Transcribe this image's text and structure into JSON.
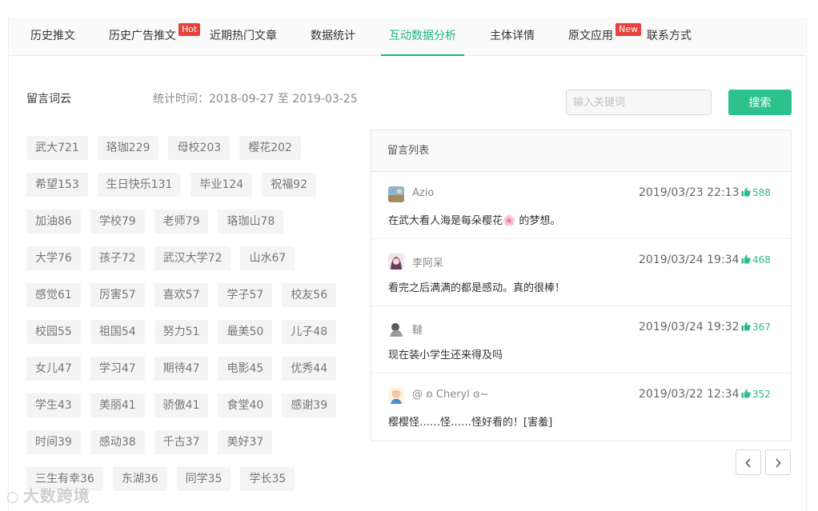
{
  "tabs": [
    {
      "label": "历史推文",
      "active": false
    },
    {
      "label": "历史广告推文",
      "active": false,
      "badge": "Hot"
    },
    {
      "label": "近期热门文章",
      "active": false
    },
    {
      "label": "数据统计",
      "active": false
    },
    {
      "label": "互动数据分析",
      "active": true
    },
    {
      "label": "主体详情",
      "active": false
    },
    {
      "label": "原文应用",
      "active": false,
      "badge": "New"
    },
    {
      "label": "联系方式",
      "active": false
    }
  ],
  "wordcloud": {
    "title": "留言词云",
    "stat_time": "统计时间：2018-09-27 至 2019-03-25",
    "rows": [
      [
        "武大721",
        "珞珈229",
        "母校203",
        "樱花202"
      ],
      [
        "希望153",
        "生日快乐131",
        "毕业124",
        "祝福92"
      ],
      [
        "加油86",
        "学校79",
        "老师79",
        "珞珈山78"
      ],
      [
        "大学76",
        "孩子72",
        "武汉大学72",
        "山水67"
      ],
      [
        "感觉61",
        "厉害57",
        "喜欢57",
        "学子57",
        "校友56"
      ],
      [
        "校园55",
        "祖国54",
        "努力51",
        "最美50",
        "儿子48"
      ],
      [
        "女儿47",
        "学习47",
        "期待47",
        "电影45",
        "优秀44"
      ],
      [
        "学生43",
        "美丽41",
        "骄傲41",
        "食堂40",
        "感谢39"
      ],
      [
        "时间39",
        "感动38",
        "千古37",
        "美好37"
      ],
      [
        "三生有幸36",
        "东湖36",
        "同学35",
        "学长35"
      ]
    ]
  },
  "search": {
    "placeholder": "输入关键词",
    "value": "",
    "button_label": "搜索"
  },
  "comments_panel": {
    "title": "留言列表",
    "comments": [
      {
        "name": "Azio",
        "time": "2019/03/23 22:13",
        "likes": "588",
        "text": "在武大看人海是每朵樱花🌸 的梦想。"
      },
      {
        "name": "李阿呆",
        "time": "2019/03/24 19:34",
        "likes": "468",
        "text": "看完之后满满的都是感动。真的很棒！"
      },
      {
        "name": "韃",
        "time": "2019/03/24 19:32",
        "likes": "367",
        "text": "现在装小学生还来得及吗"
      },
      {
        "name": "@ ʚ Cheryl ɞ~",
        "time": "2019/03/22 12:34",
        "likes": "352",
        "text": "樱樱怪……怪……怪好看的！[害羞]"
      }
    ]
  },
  "pager": {
    "prev_icon": "chevron-left-icon",
    "next_icon": "chevron-right-icon"
  },
  "watermark": {
    "text": "大数跨境"
  },
  "colors": {
    "accent": "#2dc18e",
    "badge": "#e8403a"
  }
}
